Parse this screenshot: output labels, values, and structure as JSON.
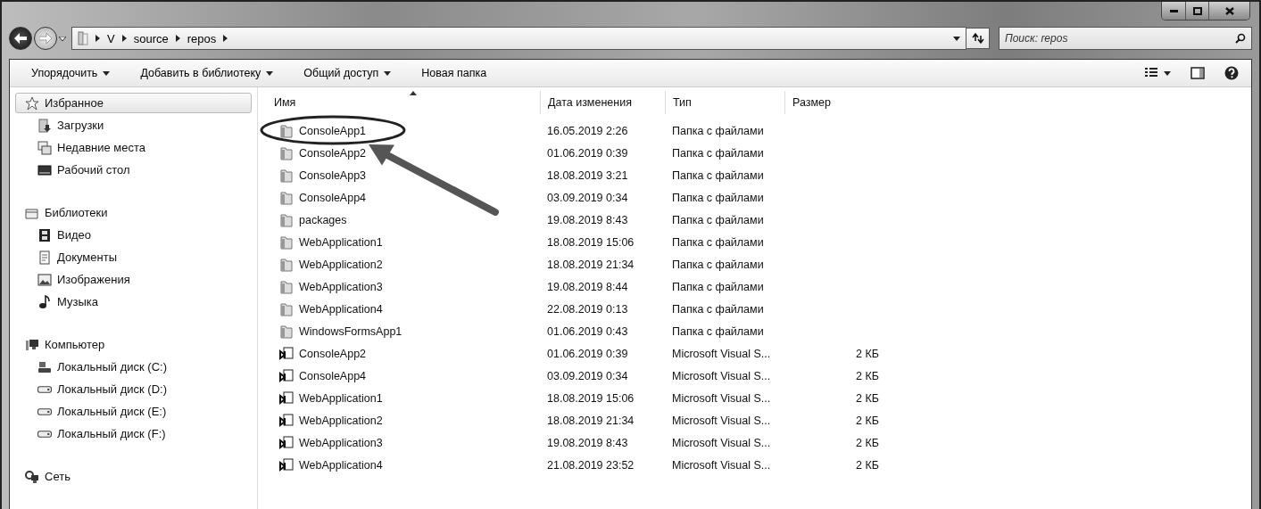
{
  "address": {
    "crumbs": [
      "V",
      "source",
      "repos"
    ]
  },
  "search": {
    "placeholder": "Поиск: repos"
  },
  "toolbar": {
    "buttons": [
      {
        "label": "Упорядочить",
        "dropdown": true
      },
      {
        "label": "Добавить в библиотеку",
        "dropdown": true
      },
      {
        "label": "Общий доступ",
        "dropdown": true
      },
      {
        "label": "Новая папка",
        "dropdown": false
      }
    ]
  },
  "sidebar": {
    "groups": [
      {
        "label": "Избранное",
        "selected": true,
        "children": [
          {
            "label": "Загрузки",
            "selected": false
          },
          {
            "label": "Недавние места",
            "selected": false
          },
          {
            "label": "Рабочий стол",
            "selected": false
          }
        ]
      },
      {
        "label": "Библиотеки",
        "selected": false,
        "children": [
          {
            "label": "Видео",
            "selected": false
          },
          {
            "label": "Документы",
            "selected": false
          },
          {
            "label": "Изображения",
            "selected": false
          },
          {
            "label": "Музыка",
            "selected": false
          }
        ]
      },
      {
        "label": "Компьютер",
        "selected": false,
        "children": [
          {
            "label": "Локальный диск (C:)",
            "selected": false
          },
          {
            "label": "Локальный диск (D:)",
            "selected": false
          },
          {
            "label": "Локальный диск (E:)",
            "selected": false
          },
          {
            "label": "Локальный диск (F:)",
            "selected": false
          }
        ]
      },
      {
        "label": "Сеть",
        "selected": false
      }
    ]
  },
  "table": {
    "columns": [
      "Имя",
      "Дата изменения",
      "Тип",
      "Размер"
    ],
    "rows": [
      {
        "kind": "folder",
        "name": "ConsoleApp1",
        "date": "16.05.2019 2:26",
        "type": "Папка с файлами"
      },
      {
        "kind": "folder",
        "name": "ConsoleApp2",
        "date": "01.06.2019 0:39",
        "type": "Папка с файлами"
      },
      {
        "kind": "folder",
        "name": "ConsoleApp3",
        "date": "18.08.2019 3:21",
        "type": "Папка с файлами"
      },
      {
        "kind": "folder",
        "name": "ConsoleApp4",
        "date": "03.09.2019 0:34",
        "type": "Папка с файлами"
      },
      {
        "kind": "folder",
        "name": "packages",
        "date": "19.08.2019 8:43",
        "type": "Папка с файлами"
      },
      {
        "kind": "folder",
        "name": "WebApplication1",
        "date": "18.08.2019 15:06",
        "type": "Папка с файлами"
      },
      {
        "kind": "folder",
        "name": "WebApplication2",
        "date": "18.08.2019 21:34",
        "type": "Папка с файлами"
      },
      {
        "kind": "folder",
        "name": "WebApplication3",
        "date": "19.08.2019 8:44",
        "type": "Папка с файлами"
      },
      {
        "kind": "folder",
        "name": "WebApplication4",
        "date": "22.08.2019 0:13",
        "type": "Папка с файлами"
      },
      {
        "kind": "folder",
        "name": "WindowsFormsApp1",
        "date": "01.06.2019 0:43",
        "type": "Папка с файлами"
      },
      {
        "kind": "solution",
        "name": "ConsoleApp2",
        "date": "01.06.2019 0:39",
        "type": "Microsoft Visual S...",
        "size": "2 КБ"
      },
      {
        "kind": "solution",
        "name": "ConsoleApp4",
        "date": "03.09.2019 0:34",
        "type": "Microsoft Visual S...",
        "size": "2 КБ"
      },
      {
        "kind": "solution",
        "name": "WebApplication1",
        "date": "18.08.2019 15:06",
        "type": "Microsoft Visual S...",
        "size": "2 КБ"
      },
      {
        "kind": "solution",
        "name": "WebApplication2",
        "date": "18.08.2019 21:34",
        "type": "Microsoft Visual S...",
        "size": "2 КБ"
      },
      {
        "kind": "solution",
        "name": "WebApplication3",
        "date": "19.08.2019 8:43",
        "type": "Microsoft Visual S...",
        "size": "2 КБ"
      },
      {
        "kind": "solution",
        "name": "WebApplication4",
        "date": "21.08.2019 23:52",
        "type": "Microsoft Visual S...",
        "size": "2 КБ"
      }
    ]
  }
}
